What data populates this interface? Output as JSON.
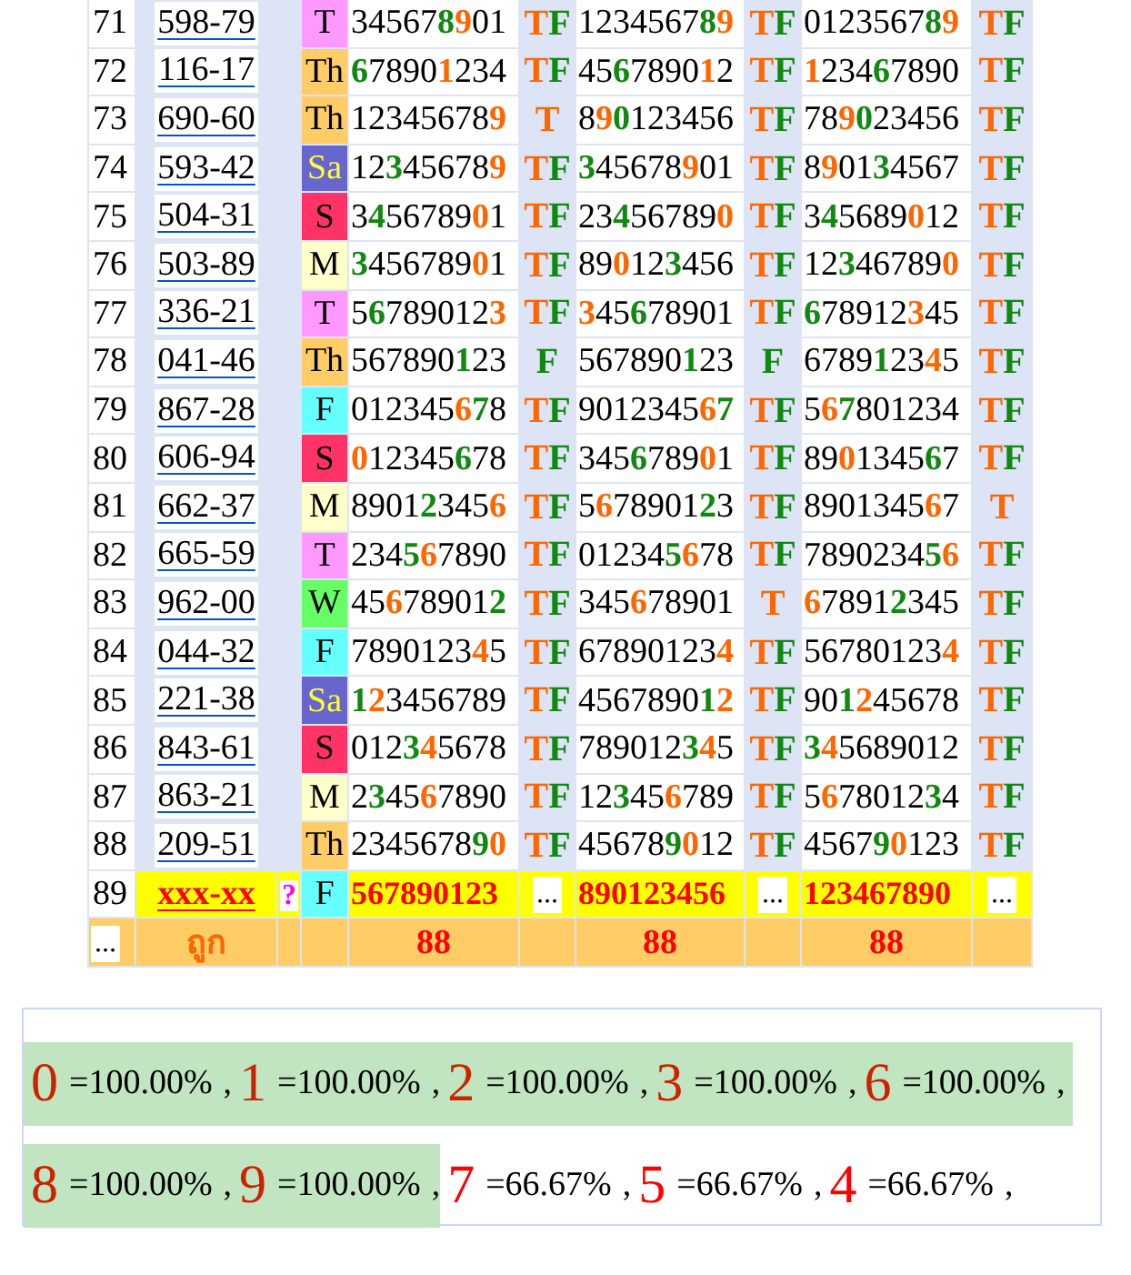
{
  "rows": [
    {
      "num": "71",
      "id": "598-79",
      "day": {
        "label": "T",
        "color": "#ff99ff"
      },
      "cells": [
        {
          "parts": [
            {
              "text": "34567",
              "kind": "plain"
            },
            {
              "text": "8",
              "kind": "green"
            },
            {
              "text": "9",
              "kind": "orange"
            },
            {
              "text": "01",
              "kind": "plain"
            }
          ],
          "t": "T",
          "f": "F"
        },
        {
          "parts": [
            {
              "text": "1234567",
              "kind": "plain"
            },
            {
              "text": "8",
              "kind": "green"
            },
            {
              "text": "9",
              "kind": "orange"
            }
          ],
          "t": "T",
          "f": "F"
        },
        {
          "parts": [
            {
              "text": "0123567",
              "kind": "plain"
            },
            {
              "text": "8",
              "kind": "green"
            },
            {
              "text": "9",
              "kind": "orange"
            }
          ],
          "t": "T",
          "f": "F"
        }
      ]
    },
    {
      "num": "72",
      "id": "116-17",
      "day": {
        "label": "Th",
        "color": "#ffcc66"
      },
      "cells": [
        {
          "parts": [
            {
              "text": "6",
              "kind": "green"
            },
            {
              "text": "7890",
              "kind": "plain"
            },
            {
              "text": "1",
              "kind": "orange"
            },
            {
              "text": "234",
              "kind": "plain"
            }
          ],
          "t": "T",
          "f": "F"
        },
        {
          "parts": [
            {
              "text": "45",
              "kind": "plain"
            },
            {
              "text": "6",
              "kind": "green"
            },
            {
              "text": "7890",
              "kind": "plain"
            },
            {
              "text": "1",
              "kind": "orange"
            },
            {
              "text": "2",
              "kind": "plain"
            }
          ],
          "t": "T",
          "f": "F"
        },
        {
          "parts": [
            {
              "text": "1",
              "kind": "orange"
            },
            {
              "text": "234",
              "kind": "plain"
            },
            {
              "text": "6",
              "kind": "green"
            },
            {
              "text": "7890",
              "kind": "plain"
            }
          ],
          "t": "T",
          "f": "F"
        }
      ]
    },
    {
      "num": "73",
      "id": "690-60",
      "day": {
        "label": "Th",
        "color": "#ffcc66"
      },
      "cells": [
        {
          "parts": [
            {
              "text": "12345678",
              "kind": "plain"
            },
            {
              "text": "9",
              "kind": "orange"
            }
          ],
          "t": "T"
        },
        {
          "parts": [
            {
              "text": "8",
              "kind": "plain"
            },
            {
              "text": "9",
              "kind": "orange"
            },
            {
              "text": "0",
              "kind": "green"
            },
            {
              "text": "123456",
              "kind": "plain"
            }
          ],
          "t": "T",
          "f": "F"
        },
        {
          "parts": [
            {
              "text": "78",
              "kind": "plain"
            },
            {
              "text": "9",
              "kind": "orange"
            },
            {
              "text": "0",
              "kind": "green"
            },
            {
              "text": "23456",
              "kind": "plain"
            }
          ],
          "t": "T",
          "f": "F"
        }
      ]
    },
    {
      "num": "74",
      "id": "593-42",
      "day": {
        "label": "Sa",
        "color": "#6666cc",
        "light_text": true
      },
      "cells": [
        {
          "parts": [
            {
              "text": "12",
              "kind": "plain"
            },
            {
              "text": "3",
              "kind": "green"
            },
            {
              "text": "45678",
              "kind": "plain"
            },
            {
              "text": "9",
              "kind": "orange"
            }
          ],
          "t": "T",
          "f": "F"
        },
        {
          "parts": [
            {
              "text": "3",
              "kind": "green"
            },
            {
              "text": "45678",
              "kind": "plain"
            },
            {
              "text": "9",
              "kind": "orange"
            },
            {
              "text": "01",
              "kind": "plain"
            }
          ],
          "t": "T",
          "f": "F"
        },
        {
          "parts": [
            {
              "text": "8",
              "kind": "plain"
            },
            {
              "text": "9",
              "kind": "orange"
            },
            {
              "text": "01",
              "kind": "plain"
            },
            {
              "text": "3",
              "kind": "green"
            },
            {
              "text": "4567",
              "kind": "plain"
            }
          ],
          "t": "T",
          "f": "F"
        }
      ]
    },
    {
      "num": "75",
      "id": "504-31",
      "day": {
        "label": "S",
        "color": "#ff3366"
      },
      "cells": [
        {
          "parts": [
            {
              "text": "3",
              "kind": "plain"
            },
            {
              "text": "4",
              "kind": "green"
            },
            {
              "text": "56789",
              "kind": "plain"
            },
            {
              "text": "0",
              "kind": "orange"
            },
            {
              "text": "1",
              "kind": "plain"
            }
          ],
          "t": "T",
          "f": "F"
        },
        {
          "parts": [
            {
              "text": "23",
              "kind": "plain"
            },
            {
              "text": "4",
              "kind": "green"
            },
            {
              "text": "56789",
              "kind": "plain"
            },
            {
              "text": "0",
              "kind": "orange"
            }
          ],
          "t": "T",
          "f": "F"
        },
        {
          "parts": [
            {
              "text": "3",
              "kind": "plain"
            },
            {
              "text": "4",
              "kind": "green"
            },
            {
              "text": "5689",
              "kind": "plain"
            },
            {
              "text": "0",
              "kind": "orange"
            },
            {
              "text": "12",
              "kind": "plain"
            }
          ],
          "t": "T",
          "f": "F"
        }
      ]
    },
    {
      "num": "76",
      "id": "503-89",
      "day": {
        "label": "M",
        "color": "#ffffcc"
      },
      "cells": [
        {
          "parts": [
            {
              "text": "3",
              "kind": "green"
            },
            {
              "text": "456789",
              "kind": "plain"
            },
            {
              "text": "0",
              "kind": "orange"
            },
            {
              "text": "1",
              "kind": "plain"
            }
          ],
          "t": "T",
          "f": "F"
        },
        {
          "parts": [
            {
              "text": "89",
              "kind": "plain"
            },
            {
              "text": "0",
              "kind": "orange"
            },
            {
              "text": "12",
              "kind": "plain"
            },
            {
              "text": "3",
              "kind": "green"
            },
            {
              "text": "456",
              "kind": "plain"
            }
          ],
          "t": "T",
          "f": "F"
        },
        {
          "parts": [
            {
              "text": "12",
              "kind": "plain"
            },
            {
              "text": "3",
              "kind": "green"
            },
            {
              "text": "46789",
              "kind": "plain"
            },
            {
              "text": "0",
              "kind": "orange"
            }
          ],
          "t": "T",
          "f": "F"
        }
      ]
    },
    {
      "num": "77",
      "id": "336-21",
      "day": {
        "label": "T",
        "color": "#ff99ff"
      },
      "cells": [
        {
          "parts": [
            {
              "text": "5",
              "kind": "plain"
            },
            {
              "text": "6",
              "kind": "green"
            },
            {
              "text": "789012",
              "kind": "plain"
            },
            {
              "text": "3",
              "kind": "orange"
            }
          ],
          "t": "T",
          "f": "F"
        },
        {
          "parts": [
            {
              "text": "3",
              "kind": "orange"
            },
            {
              "text": "45",
              "kind": "plain"
            },
            {
              "text": "6",
              "kind": "green"
            },
            {
              "text": "78901",
              "kind": "plain"
            }
          ],
          "t": "T",
          "f": "F"
        },
        {
          "parts": [
            {
              "text": "6",
              "kind": "green"
            },
            {
              "text": "78912",
              "kind": "plain"
            },
            {
              "text": "3",
              "kind": "orange"
            },
            {
              "text": "45",
              "kind": "plain"
            }
          ],
          "t": "T",
          "f": "F"
        }
      ]
    },
    {
      "num": "78",
      "id": "041-46",
      "day": {
        "label": "Th",
        "color": "#ffcc66"
      },
      "cells": [
        {
          "parts": [
            {
              "text": "567890",
              "kind": "plain"
            },
            {
              "text": "1",
              "kind": "green"
            },
            {
              "text": "23",
              "kind": "plain"
            }
          ],
          "f": "F"
        },
        {
          "parts": [
            {
              "text": "567890",
              "kind": "plain"
            },
            {
              "text": "1",
              "kind": "green"
            },
            {
              "text": "23",
              "kind": "plain"
            }
          ],
          "f": "F"
        },
        {
          "parts": [
            {
              "text": "6789",
              "kind": "plain"
            },
            {
              "text": "1",
              "kind": "green"
            },
            {
              "text": "23",
              "kind": "plain"
            },
            {
              "text": "4",
              "kind": "orange"
            },
            {
              "text": "5",
              "kind": "plain"
            }
          ],
          "t": "T",
          "f": "F"
        }
      ]
    },
    {
      "num": "79",
      "id": "867-28",
      "day": {
        "label": "F",
        "color": "#66ffff"
      },
      "cells": [
        {
          "parts": [
            {
              "text": "012345",
              "kind": "plain"
            },
            {
              "text": "6",
              "kind": "orange"
            },
            {
              "text": "7",
              "kind": "green"
            },
            {
              "text": "8",
              "kind": "plain"
            }
          ],
          "t": "T",
          "f": "F"
        },
        {
          "parts": [
            {
              "text": "9012345",
              "kind": "plain"
            },
            {
              "text": "6",
              "kind": "orange"
            },
            {
              "text": "7",
              "kind": "green"
            }
          ],
          "t": "T",
          "f": "F"
        },
        {
          "parts": [
            {
              "text": "5",
              "kind": "plain"
            },
            {
              "text": "6",
              "kind": "orange"
            },
            {
              "text": "7",
              "kind": "green"
            },
            {
              "text": "801234",
              "kind": "plain"
            }
          ],
          "t": "T",
          "f": "F"
        }
      ]
    },
    {
      "num": "80",
      "id": "606-94",
      "day": {
        "label": "S",
        "color": "#ff3366"
      },
      "cells": [
        {
          "parts": [
            {
              "text": "0",
              "kind": "orange"
            },
            {
              "text": "12345",
              "kind": "plain"
            },
            {
              "text": "6",
              "kind": "green"
            },
            {
              "text": "78",
              "kind": "plain"
            }
          ],
          "t": "T",
          "f": "F"
        },
        {
          "parts": [
            {
              "text": "345",
              "kind": "plain"
            },
            {
              "text": "6",
              "kind": "green"
            },
            {
              "text": "789",
              "kind": "plain"
            },
            {
              "text": "0",
              "kind": "orange"
            },
            {
              "text": "1",
              "kind": "plain"
            }
          ],
          "t": "T",
          "f": "F"
        },
        {
          "parts": [
            {
              "text": "89",
              "kind": "plain"
            },
            {
              "text": "0",
              "kind": "orange"
            },
            {
              "text": "1345",
              "kind": "plain"
            },
            {
              "text": "6",
              "kind": "green"
            },
            {
              "text": "7",
              "kind": "plain"
            }
          ],
          "t": "T",
          "f": "F"
        }
      ]
    },
    {
      "num": "81",
      "id": "662-37",
      "day": {
        "label": "M",
        "color": "#ffffcc"
      },
      "cells": [
        {
          "parts": [
            {
              "text": "8901",
              "kind": "plain"
            },
            {
              "text": "2",
              "kind": "green"
            },
            {
              "text": "345",
              "kind": "plain"
            },
            {
              "text": "6",
              "kind": "orange"
            }
          ],
          "t": "T",
          "f": "F"
        },
        {
          "parts": [
            {
              "text": "5",
              "kind": "plain"
            },
            {
              "text": "6",
              "kind": "orange"
            },
            {
              "text": "78901",
              "kind": "plain"
            },
            {
              "text": "2",
              "kind": "green"
            },
            {
              "text": "3",
              "kind": "plain"
            }
          ],
          "t": "T",
          "f": "F"
        },
        {
          "parts": [
            {
              "text": "8901345",
              "kind": "plain"
            },
            {
              "text": "6",
              "kind": "orange"
            },
            {
              "text": "7",
              "kind": "plain"
            }
          ],
          "t": "T"
        }
      ]
    },
    {
      "num": "82",
      "id": "665-59",
      "day": {
        "label": "T",
        "color": "#ff99ff"
      },
      "cells": [
        {
          "parts": [
            {
              "text": "234",
              "kind": "plain"
            },
            {
              "text": "5",
              "kind": "green"
            },
            {
              "text": "6",
              "kind": "orange"
            },
            {
              "text": "7890",
              "kind": "plain"
            }
          ],
          "t": "T",
          "f": "F"
        },
        {
          "parts": [
            {
              "text": "01234",
              "kind": "plain"
            },
            {
              "text": "5",
              "kind": "green"
            },
            {
              "text": "6",
              "kind": "orange"
            },
            {
              "text": "78",
              "kind": "plain"
            }
          ],
          "t": "T",
          "f": "F"
        },
        {
          "parts": [
            {
              "text": "7890234",
              "kind": "plain"
            },
            {
              "text": "5",
              "kind": "green"
            },
            {
              "text": "6",
              "kind": "orange"
            }
          ],
          "t": "T",
          "f": "F"
        }
      ]
    },
    {
      "num": "83",
      "id": "962-00",
      "day": {
        "label": "W",
        "color": "#66ff66"
      },
      "cells": [
        {
          "parts": [
            {
              "text": "45",
              "kind": "plain"
            },
            {
              "text": "6",
              "kind": "orange"
            },
            {
              "text": "78901",
              "kind": "plain"
            },
            {
              "text": "2",
              "kind": "green"
            }
          ],
          "t": "T",
          "f": "F"
        },
        {
          "parts": [
            {
              "text": "345",
              "kind": "plain"
            },
            {
              "text": "6",
              "kind": "orange"
            },
            {
              "text": "78901",
              "kind": "plain"
            }
          ],
          "t": "T"
        },
        {
          "parts": [
            {
              "text": "6",
              "kind": "orange"
            },
            {
              "text": "7891",
              "kind": "plain"
            },
            {
              "text": "2",
              "kind": "green"
            },
            {
              "text": "345",
              "kind": "plain"
            }
          ],
          "t": "T",
          "f": "F"
        }
      ]
    },
    {
      "num": "84",
      "id": "044-32",
      "day": {
        "label": "F",
        "color": "#66ffff"
      },
      "cells": [
        {
          "parts": [
            {
              "text": "7890123",
              "kind": "plain"
            },
            {
              "text": "4",
              "kind": "orange"
            },
            {
              "text": "5",
              "kind": "plain"
            }
          ],
          "t": "T",
          "f": "F"
        },
        {
          "parts": [
            {
              "text": "67890123",
              "kind": "plain"
            },
            {
              "text": "4",
              "kind": "orange"
            }
          ],
          "t": "T",
          "f": "F"
        },
        {
          "parts": [
            {
              "text": "56780123",
              "kind": "plain"
            },
            {
              "text": "4",
              "kind": "orange"
            }
          ],
          "t": "T",
          "f": "F"
        }
      ]
    },
    {
      "num": "85",
      "id": "221-38",
      "day": {
        "label": "Sa",
        "color": "#6666cc",
        "light_text": true
      },
      "cells": [
        {
          "parts": [
            {
              "text": "1",
              "kind": "green"
            },
            {
              "text": "2",
              "kind": "orange"
            },
            {
              "text": "3456789",
              "kind": "plain"
            }
          ],
          "t": "T",
          "f": "F"
        },
        {
          "parts": [
            {
              "text": "4567890",
              "kind": "plain"
            },
            {
              "text": "1",
              "kind": "green"
            },
            {
              "text": "2",
              "kind": "orange"
            }
          ],
          "t": "T",
          "f": "F"
        },
        {
          "parts": [
            {
              "text": "90",
              "kind": "plain"
            },
            {
              "text": "1",
              "kind": "green"
            },
            {
              "text": "2",
              "kind": "orange"
            },
            {
              "text": "45678",
              "kind": "plain"
            }
          ],
          "t": "T",
          "f": "F"
        }
      ]
    },
    {
      "num": "86",
      "id": "843-61",
      "day": {
        "label": "S",
        "color": "#ff3366"
      },
      "cells": [
        {
          "parts": [
            {
              "text": "012",
              "kind": "plain"
            },
            {
              "text": "3",
              "kind": "green"
            },
            {
              "text": "4",
              "kind": "orange"
            },
            {
              "text": "5678",
              "kind": "plain"
            }
          ],
          "t": "T",
          "f": "F"
        },
        {
          "parts": [
            {
              "text": "789012",
              "kind": "plain"
            },
            {
              "text": "3",
              "kind": "green"
            },
            {
              "text": "4",
              "kind": "orange"
            },
            {
              "text": "5",
              "kind": "plain"
            }
          ],
          "t": "T",
          "f": "F"
        },
        {
          "parts": [
            {
              "text": "3",
              "kind": "green"
            },
            {
              "text": "4",
              "kind": "orange"
            },
            {
              "text": "5689012",
              "kind": "plain"
            }
          ],
          "t": "T",
          "f": "F"
        }
      ]
    },
    {
      "num": "87",
      "id": "863-21",
      "day": {
        "label": "M",
        "color": "#ffffcc"
      },
      "cells": [
        {
          "parts": [
            {
              "text": "2",
              "kind": "plain"
            },
            {
              "text": "3",
              "kind": "green"
            },
            {
              "text": "45",
              "kind": "plain"
            },
            {
              "text": "6",
              "kind": "orange"
            },
            {
              "text": "7890",
              "kind": "plain"
            }
          ],
          "t": "T",
          "f": "F"
        },
        {
          "parts": [
            {
              "text": "12",
              "kind": "plain"
            },
            {
              "text": "3",
              "kind": "green"
            },
            {
              "text": "45",
              "kind": "plain"
            },
            {
              "text": "6",
              "kind": "orange"
            },
            {
              "text": "789",
              "kind": "plain"
            }
          ],
          "t": "T",
          "f": "F"
        },
        {
          "parts": [
            {
              "text": "5",
              "kind": "plain"
            },
            {
              "text": "6",
              "kind": "orange"
            },
            {
              "text": "78012",
              "kind": "plain"
            },
            {
              "text": "3",
              "kind": "green"
            },
            {
              "text": "4",
              "kind": "plain"
            }
          ],
          "t": "T",
          "f": "F"
        }
      ]
    },
    {
      "num": "88",
      "id": "209-51",
      "day": {
        "label": "Th",
        "color": "#ffcc66"
      },
      "cells": [
        {
          "parts": [
            {
              "text": "2345678",
              "kind": "plain"
            },
            {
              "text": "9",
              "kind": "green"
            },
            {
              "text": "0",
              "kind": "orange"
            }
          ],
          "t": "T",
          "f": "F"
        },
        {
          "parts": [
            {
              "text": "45678",
              "kind": "plain"
            },
            {
              "text": "9",
              "kind": "green"
            },
            {
              "text": "0",
              "kind": "orange"
            },
            {
              "text": "12",
              "kind": "plain"
            }
          ],
          "t": "T",
          "f": "F"
        },
        {
          "parts": [
            {
              "text": "4567",
              "kind": "plain"
            },
            {
              "text": "9",
              "kind": "green"
            },
            {
              "text": "0",
              "kind": "orange"
            },
            {
              "text": "123",
              "kind": "plain"
            }
          ],
          "t": "T",
          "f": "F"
        }
      ]
    }
  ],
  "pending_row": {
    "num": "89",
    "id": "xxx-xx",
    "query": "?",
    "day": {
      "label": "F",
      "color": "#66ffff"
    },
    "cells": [
      {
        "digits": "567890123",
        "mark": "..."
      },
      {
        "digits": "890123456",
        "mark": "..."
      },
      {
        "digits": "123467890",
        "mark": "..."
      }
    ]
  },
  "footer": {
    "more": "...",
    "label": "ถูก",
    "totals": [
      "88",
      "88",
      "88"
    ]
  },
  "stats": [
    {
      "digit": "0",
      "value": "=100.00%",
      "sep": ",",
      "highlighted": true
    },
    {
      "digit": "1",
      "value": "=100.00%",
      "sep": ",",
      "highlighted": true
    },
    {
      "digit": "2",
      "value": "=100.00%",
      "sep": ",",
      "highlighted": true
    },
    {
      "digit": "3",
      "value": "=100.00%",
      "sep": ",",
      "highlighted": true
    },
    {
      "digit": "6",
      "value": "=100.00%",
      "sep": ",",
      "highlighted": true
    },
    {
      "digit": "8",
      "value": "=100.00%",
      "sep": ",",
      "highlighted": true
    },
    {
      "digit": "9",
      "value": "=100.00%",
      "sep": ",",
      "highlighted": true
    },
    {
      "digit": "7",
      "value": "=66.67%",
      "sep": ",",
      "highlighted": false
    },
    {
      "digit": "5",
      "value": "=66.67%",
      "sep": ",",
      "highlighted": false
    },
    {
      "digit": "4",
      "value": "=66.67%",
      "sep": ",",
      "highlighted": false
    }
  ]
}
